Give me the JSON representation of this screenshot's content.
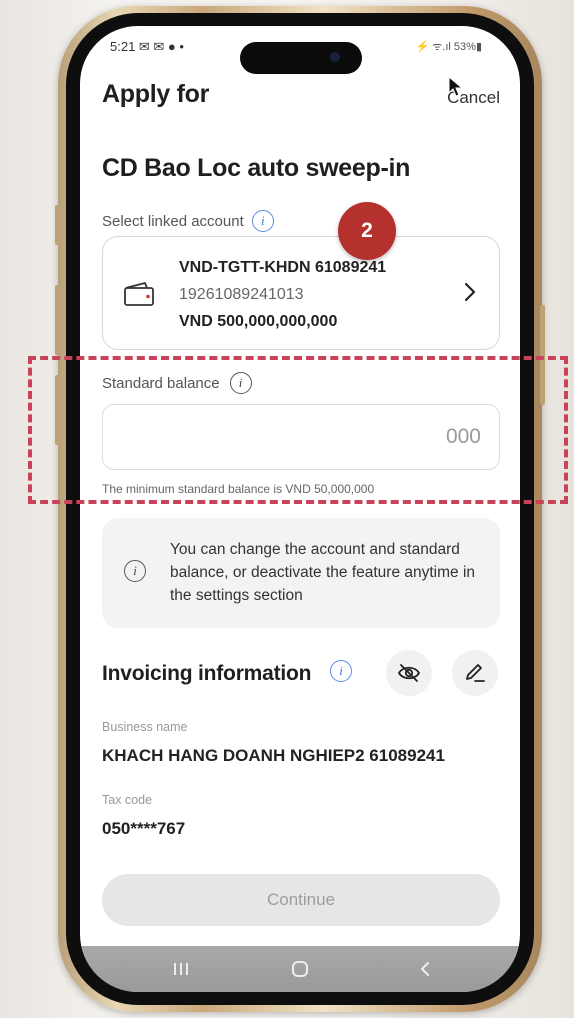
{
  "status_bar": {
    "time": "5:21 ✉ ✉ ● •",
    "right_icons": "⚡ ᯤ.ıl 53%▮"
  },
  "header": {
    "title": "Apply for",
    "cancel_label": "Cancel"
  },
  "product": {
    "title": "CD Bao Loc auto sweep-in"
  },
  "linked_account": {
    "label": "Select linked account",
    "info_icon": "i",
    "step_badge": "2",
    "name": "VND-TGTT-KHDN 61089241",
    "number": "19261089241013",
    "balance": "VND 500,000,000,000"
  },
  "standard_balance": {
    "label": "Standard balance",
    "info_icon": "i",
    "placeholder": "000",
    "hint": "The minimum standard balance is VND 50,000,000"
  },
  "notice": {
    "icon": "i",
    "text": "You can change the account and standard balance, or deactivate the feature anytime in the settings section"
  },
  "invoicing": {
    "title": "Invoicing information",
    "info_icon": "i",
    "business_name_label": "Business name",
    "business_name_value": "KHACH HANG DOANH NGHIEP2 61089241",
    "tax_code_label": "Tax code",
    "tax_code_value": "050****767"
  },
  "continue_label": "Continue",
  "icons": {
    "wallet": "wallet-icon",
    "chevron": "chevron-right-icon",
    "eye_hidden": "eye-off-icon",
    "edit": "pencil-icon",
    "nav_recent": "recent-apps-icon",
    "nav_home": "home-icon",
    "nav_back": "back-icon"
  },
  "colors": {
    "accent_blue": "#3d74d6",
    "badge_red": "#b5312d",
    "highlight_dash": "#c9425a",
    "phone_gold": "#caa87c"
  }
}
